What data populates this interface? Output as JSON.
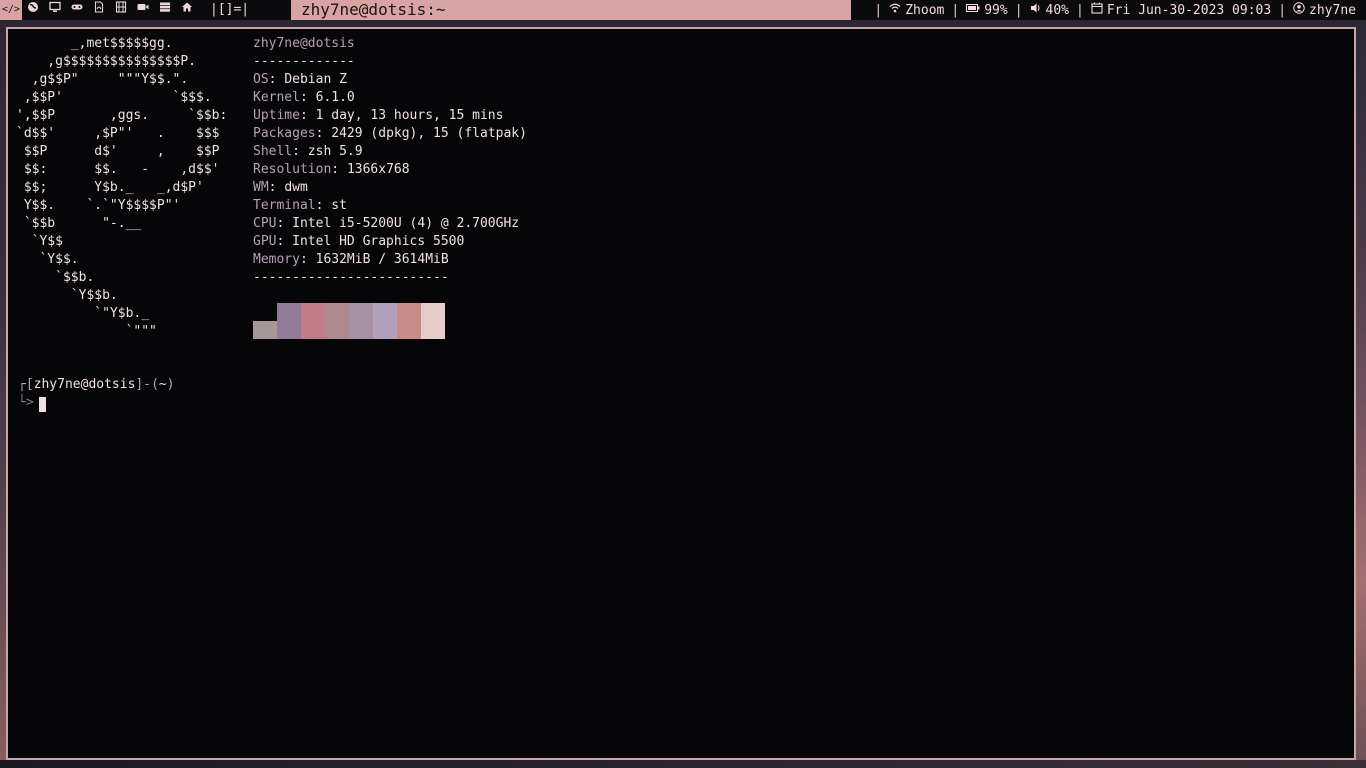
{
  "bar": {
    "tags": [
      {
        "icon": "code-icon",
        "glyph": "</>"
      },
      {
        "icon": "globe-icon"
      },
      {
        "icon": "monitor-icon"
      },
      {
        "icon": "gamepad-icon"
      },
      {
        "icon": "pdf-file-icon"
      },
      {
        "icon": "film-icon"
      },
      {
        "icon": "video-camera-icon"
      },
      {
        "icon": "server-icon"
      },
      {
        "icon": "home-icon"
      }
    ],
    "layout": "|[]=|",
    "window_title": "zhy7ne@dotsis:~",
    "status": {
      "wifi": "Zhoom",
      "battery": "99%",
      "volume": "40%",
      "datetime": "Fri Jun-30-2023 09:03",
      "user": "zhy7ne"
    },
    "separator": "|",
    "colors": {
      "accent": "#d7a3a3",
      "bar_bg": "#0b0a0d",
      "border": "#c8a6a6"
    }
  },
  "terminal": {
    "logo": [
      "       _,met$$$$$gg.",
      "    ,g$$$$$$$$$$$$$$$P.",
      "  ,g$$P\"     \"\"\"Y$$.\".",
      " ,$$P'              `$$$.",
      "',$$P       ,ggs.     `$$b:",
      "`d$$'     ,$P\"'   .    $$$",
      " $$P      d$'     ,    $$P",
      " $$:      $$.   -    ,d$$'",
      " $$;      Y$b._   _,d$P'",
      " Y$$.    `.`\"Y$$$$P\"'",
      " `$$b      \"-.__",
      "  `Y$$",
      "   `Y$$.",
      "     `$$b.",
      "       `Y$$b.",
      "          `\"Y$b._",
      "              `\"\"\""
    ],
    "header": "zhy7ne@dotsis",
    "dashes_short": "-------------",
    "info": [
      {
        "key": "OS",
        "value": "Debian Z"
      },
      {
        "key": "Kernel",
        "value": "6.1.0"
      },
      {
        "key": "Uptime",
        "value": "1 day, 13 hours, 15 mins"
      },
      {
        "key": "Packages",
        "value": "2429 (dpkg), 15 (flatpak)"
      },
      {
        "key": "Shell",
        "value": "zsh 5.9"
      },
      {
        "key": "Resolution",
        "value": "1366x768"
      },
      {
        "key": "WM",
        "value": "dwm"
      },
      {
        "key": "Terminal",
        "value": "st"
      },
      {
        "key": "CPU",
        "value": "Intel i5-5200U (4) @ 2.700GHz"
      },
      {
        "key": "GPU",
        "value": "Intel HD Graphics 5500"
      },
      {
        "key": "Memory",
        "value": "1632MiB / 3614MiB"
      }
    ],
    "dashes_long": "-------------------------",
    "palette": [
      "#a49898",
      "#907c98",
      "#c07c88",
      "#b08890",
      "#a890a4",
      "#b0a0bc",
      "#c88c88",
      "#e8cccc"
    ],
    "prompt": {
      "open": "┌[",
      "user": "zhy7ne",
      "at": "@",
      "host": "dotsis",
      "close": "]-(",
      "dir": "~",
      "end": ")",
      "arrow": "└>"
    }
  }
}
